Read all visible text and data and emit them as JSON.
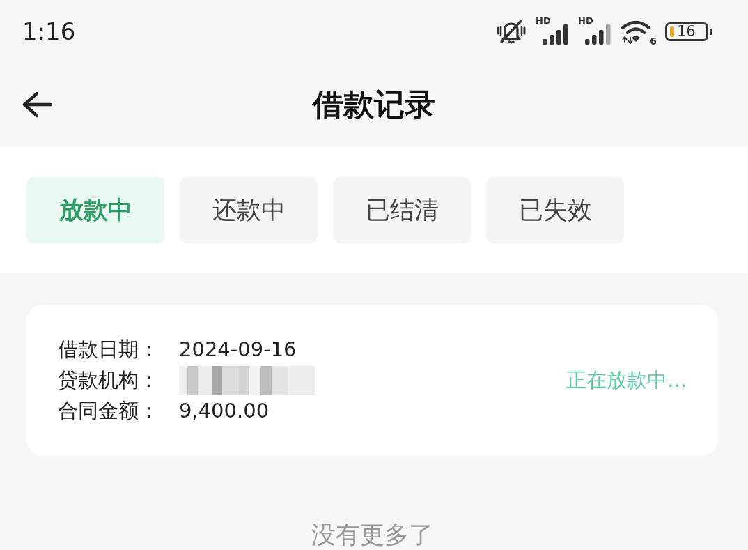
{
  "status_bar": {
    "time": "1:16",
    "signals": [
      {
        "tag": "HD"
      },
      {
        "tag": "HD"
      }
    ],
    "wifi_tag": "6",
    "battery": "16"
  },
  "header": {
    "title": "借款记录"
  },
  "tabs": [
    {
      "label": "放款中",
      "selected": true
    },
    {
      "label": "还款中",
      "selected": false
    },
    {
      "label": "已结清",
      "selected": false
    },
    {
      "label": "已失效",
      "selected": false
    }
  ],
  "records": [
    {
      "fields": [
        {
          "label": "借款日期：",
          "kind": "text",
          "value": "2024-09-16"
        },
        {
          "label": "贷款机构：",
          "kind": "redacted"
        },
        {
          "label": "合同金额：",
          "kind": "text",
          "value": "9,400.00"
        }
      ],
      "status": "正在放款中..."
    }
  ],
  "footer_note": "没有更多了"
}
